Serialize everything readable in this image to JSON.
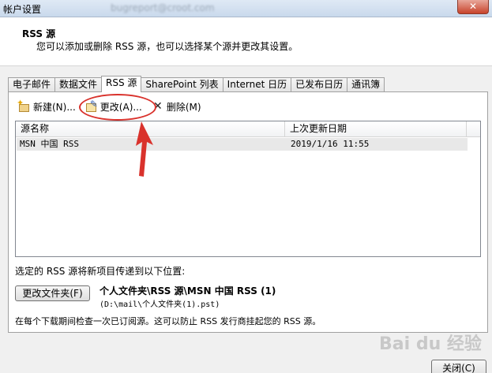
{
  "window": {
    "title": "帐户设置",
    "blurred_account": "bugreport@croot.com",
    "close_glyph": "✕"
  },
  "header": {
    "title": "RSS 源",
    "description": "您可以添加或删除 RSS 源，也可以选择某个源并更改其设置。"
  },
  "tabs": [
    {
      "label": "电子邮件"
    },
    {
      "label": "数据文件"
    },
    {
      "label": "RSS 源"
    },
    {
      "label": "SharePoint 列表"
    },
    {
      "label": "Internet 日历"
    },
    {
      "label": "已发布日历"
    },
    {
      "label": "通讯簿"
    }
  ],
  "toolbar": {
    "new_label": "新建(N)...",
    "change_label": "更改(A)...",
    "delete_label": "删除(M)",
    "icons": {
      "new": "new-feed-icon",
      "change": "edit-feed-icon",
      "delete": "delete-x-icon"
    }
  },
  "list": {
    "columns": [
      "源名称",
      "上次更新日期"
    ],
    "rows": [
      {
        "name": "MSN 中国 RSS",
        "updated": "2019/1/16 11:55"
      }
    ]
  },
  "delivery": {
    "label": "选定的 RSS 源将新项目传递到以下位置:",
    "button_label": "更改文件夹(F)",
    "folder_path": "个人文件夹\\RSS 源\\MSN 中国 RSS (1)",
    "file_path": "(D:\\mail\\个人文件夹(1).pst)",
    "note": "在每个下载期间检查一次已订阅源。这可以防止 RSS 发行商挂起您的 RSS 源。"
  },
  "footer": {
    "close_label": "关闭(C)"
  },
  "watermark": {
    "text": "Bai du 经验"
  },
  "colors": {
    "annotation_red": "#d9322c"
  }
}
